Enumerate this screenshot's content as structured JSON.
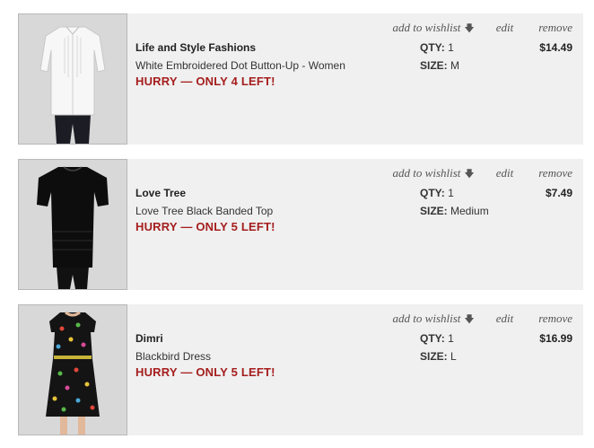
{
  "items": [
    {
      "image_icon": "white-blouse-photo",
      "brand": "Life and Style Fashions",
      "name": "White Embroidered Dot Button-Up - Women",
      "stock_notice": "HURRY — ONLY 4 LEFT!",
      "qty_label": "QTY:",
      "qty": "1",
      "size_label": "SIZE:",
      "size": "M",
      "price": "$14.49",
      "add_to_wishlist": "add to wishlist",
      "edit": "edit",
      "remove": "remove"
    },
    {
      "image_icon": "black-top-photo",
      "brand": "Love Tree",
      "name": "Love Tree Black Banded Top",
      "stock_notice": "HURRY — ONLY 5 LEFT!",
      "qty_label": "QTY:",
      "qty": "1",
      "size_label": "SIZE:",
      "size": "Medium",
      "price": "$7.49",
      "add_to_wishlist": "add to wishlist",
      "edit": "edit",
      "remove": "remove"
    },
    {
      "image_icon": "bird-print-dress-photo",
      "brand": "Dimri",
      "name": "Blackbird Dress",
      "stock_notice": "HURRY — ONLY 5 LEFT!",
      "qty_label": "QTY:",
      "qty": "1",
      "size_label": "SIZE:",
      "size": "L",
      "price": "$16.99",
      "add_to_wishlist": "add to wishlist",
      "edit": "edit",
      "remove": "remove"
    }
  ],
  "colors": {
    "panel_bg": "#f0f0f0",
    "stock_notice": "#a51d1d",
    "thumb_bg": "#d6d6d6"
  }
}
